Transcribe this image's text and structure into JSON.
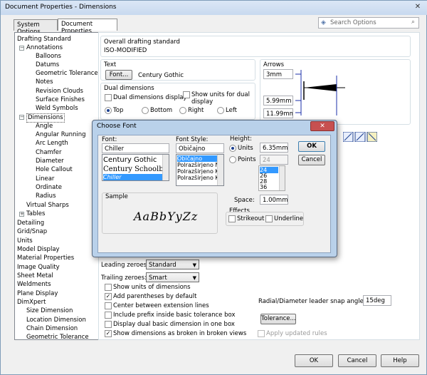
{
  "window": {
    "title": "Document Properties - Dimensions"
  },
  "tabs": [
    "System Options",
    "Document Properties"
  ],
  "search": {
    "placeholder": "Search Options"
  },
  "tree": {
    "items": [
      "Drafting Standard",
      "Annotations",
      "Balloons",
      "Datums",
      "Geometric Tolerance",
      "Notes",
      "Revision Clouds",
      "Surface Finishes",
      "Weld Symbols",
      "Dimensions",
      "Angle",
      "Angular Running",
      "Arc Length",
      "Chamfer",
      "Diameter",
      "Hole Callout",
      "Linear",
      "Ordinate",
      "Radius",
      "Virtual Sharps",
      "Tables",
      "Detailing",
      "Grid/Snap",
      "Units",
      "Model Display",
      "Material Properties",
      "Image Quality",
      "Sheet Metal",
      "Weldments",
      "Plane Display",
      "DimXpert",
      "Size Dimension",
      "Location Dimension",
      "Chain Dimension",
      "Geometric Tolerance"
    ]
  },
  "main": {
    "overall_label": "Overall drafting standard",
    "overall_value": "ISO-MODIFIED",
    "text_label": "Text",
    "font_button": "Font...",
    "font_value": "Century Gothic",
    "dual_label": "Dual dimensions",
    "dual_display": "Dual dimensions display",
    "show_units": "Show units for dual display",
    "top": "Top",
    "bottom": "Bottom",
    "right": "Right",
    "left": "Left",
    "arrows_label": "Arrows",
    "arrow_v1": "3mm",
    "arrow_v2": "5.99mm",
    "arrow_v3": "11.99mm",
    "leading_label": "Leading zeroes:",
    "leading_value": "Standard",
    "trailing_label": "Trailing zeroes:",
    "trailing_value": "Smart",
    "checks": [
      "Show units of dimensions",
      "Add parentheses by default",
      "Center between extension lines",
      "Include prefix inside basic tolerance box",
      "Display dual basic dimension in one box",
      "Show dimensions as broken in broken views"
    ],
    "snap_label": "Radial/Diameter leader snap angle:",
    "snap_value": "15deg",
    "tolerance_button": "Tolerance...",
    "apply_updated": "Apply updated rules"
  },
  "footer": {
    "ok": "OK",
    "cancel": "Cancel",
    "help": "Help"
  },
  "font_dialog": {
    "title": "Choose Font",
    "font_label": "Font:",
    "font_input": "Chiller",
    "fonts": [
      "Century Gothic",
      "Century Schoolboo",
      "Chiller"
    ],
    "style_label": "Font Style:",
    "style_input": "Običajno",
    "styles": [
      "Običajno",
      "Polrazširjeno Na",
      "Polrazširjeno Kr",
      "Polrazširjeno Kr"
    ],
    "height_label": "Height:",
    "units_label": "Units",
    "units_value": "6.35mm",
    "points_label": "Points",
    "points_value": "24",
    "point_sizes": [
      "24",
      "26",
      "28",
      "36"
    ],
    "space_label": "Space:",
    "space_value": "1.00mm",
    "effects_label": "Effects",
    "strikeout": "Strikeout",
    "underline": "Underline",
    "sample_label": "Sample",
    "sample_text": "AaBbYyZz",
    "ok": "OK",
    "cancel": "Cancel"
  },
  "colors": {
    "selection": "#3399ff",
    "title_bar": "#c8d9ef"
  }
}
